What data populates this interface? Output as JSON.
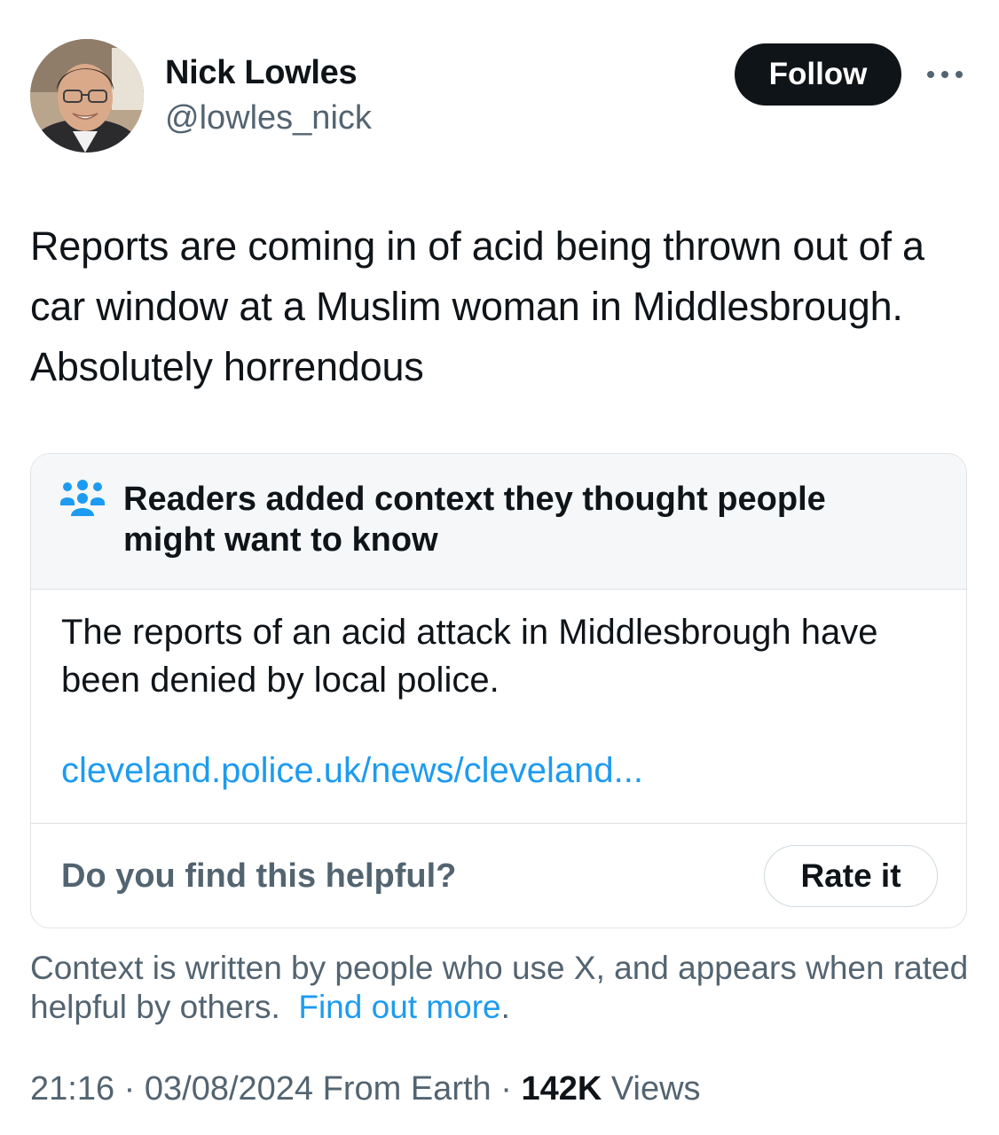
{
  "author": {
    "display_name": "Nick Lowles",
    "handle": "@lowles_nick",
    "avatar_icon": "profile-photo",
    "follow_label": "Follow",
    "more_icon": "more-horizontal-icon"
  },
  "tweet": {
    "text": "Reports are coming in of acid being thrown out of a car window at a Muslim woman in Middlesbrough. Absolutely horrendous"
  },
  "community_note": {
    "icon": "community-notes-icon",
    "title": "Readers added context they thought people might want to know",
    "body": "The reports of an acid attack in Middlesbrough have been denied by local police.",
    "link": "cleveland.police.uk/news/cleveland...",
    "helpful_question": "Do you find this helpful?",
    "rate_label": "Rate it"
  },
  "context_info": {
    "text": "Context is written by people who use X, and appears when rated helpful by others.",
    "link": "Find out more",
    "suffix": "."
  },
  "meta": {
    "time": "21:16",
    "separator": " · ",
    "date": "03/08/2024",
    "source": "From Earth",
    "views_count": "142K",
    "views_label": "Views"
  },
  "colors": {
    "text_primary": "#0f1419",
    "text_secondary": "#536471",
    "link": "#1d9bf0",
    "note_icon": "#1d9bf0",
    "follow_bg": "#0f1419",
    "note_header_bg": "#f6f7f8",
    "border": "#dfe3e6"
  }
}
